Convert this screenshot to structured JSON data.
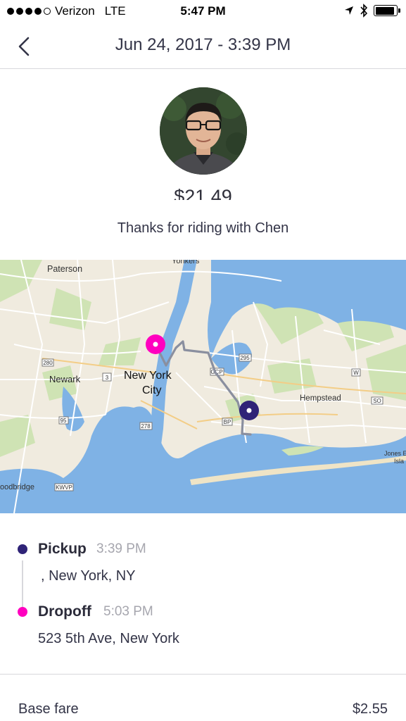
{
  "status_bar": {
    "carrier": "Verizon",
    "network": "LTE",
    "time": "5:47 PM",
    "battery_level": 0.9
  },
  "header": {
    "title": "Jun 24, 2017 - 3:39 PM"
  },
  "ride": {
    "total_fare": "$21.49",
    "thanks_message": "Thanks for riding with Chen"
  },
  "map": {
    "labels": {
      "paterson": "Paterson",
      "yonkers": "Yonkers",
      "newark": "Newark",
      "new_york": "New York",
      "city": "City",
      "hempstead": "Hempstead",
      "woodbridge": "oodbridge",
      "jones": "Jones E",
      "isla": "Isla"
    },
    "shields": {
      "i280": "280",
      "i95": "95",
      "i278": "278",
      "i295": "295",
      "gcp": "GCP",
      "bp": "BP",
      "w": "W",
      "so": "SO",
      "kwvp": "KWVP",
      "nj3": "3"
    },
    "colors": {
      "land": "#f0ebdf",
      "water": "#7fb2e5",
      "park": "#cfe3b4",
      "road": "#ffffff",
      "route": "#8a8f9f",
      "pickup": "#2f2377",
      "dropoff": "#ff00bf"
    }
  },
  "trip": {
    "pickup": {
      "label": "Pickup",
      "time": "3:39 PM",
      "address": ", New York, NY"
    },
    "dropoff": {
      "label": "Dropoff",
      "time": "5:03 PM",
      "address": "523 5th Ave, New York"
    }
  },
  "fare_breakdown": [
    {
      "label": "Base fare",
      "amount": "$2.55"
    }
  ]
}
